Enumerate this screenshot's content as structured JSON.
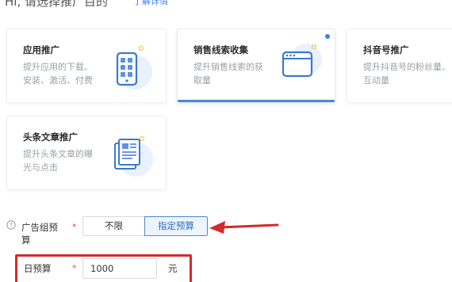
{
  "header": {
    "heading": "Hi, 请选择推广目的",
    "link": "了解详情"
  },
  "cards": [
    {
      "title": "应用推广",
      "desc": "提升应用的下载、安装、激活、付费",
      "icon": "phone-icon",
      "selected": false
    },
    {
      "title": "销售线索收集",
      "desc": "提升销售线索的获取量",
      "icon": "browser-window-icon",
      "selected": true
    },
    {
      "title": "抖音号推广",
      "desc": "提升抖音号的粉丝量、互动量",
      "icon": "profile-icon",
      "selected": false
    },
    {
      "title": "头条文章推广",
      "desc": "提升头条文章的曝光与点击",
      "icon": "article-icon",
      "selected": false
    }
  ],
  "budget": {
    "label": "广告组预算",
    "required_mark": "*",
    "options": [
      "不限",
      "指定预算"
    ],
    "selected_option": "指定预算"
  },
  "daily_budget": {
    "label": "日预算",
    "required_mark": "*",
    "value": "1000",
    "unit": "元"
  },
  "colors": {
    "accent": "#4a85d8",
    "annotation_red": "#d42a2a",
    "required_red": "#e8473d"
  }
}
